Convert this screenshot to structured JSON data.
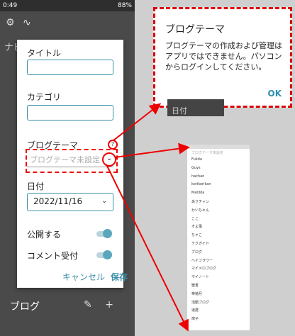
{
  "status_bar": {
    "time": "0:49",
    "battery": "88%"
  },
  "background": {
    "nav_label": "ナビ",
    "footer_label": "ブログ",
    "popup_under_label": "日付"
  },
  "dialog": {
    "title_label": "タイトル",
    "category_label": "カテゴリ",
    "blog_theme_label": "ブログテーマ",
    "blog_theme_placeholder": "ブログテーマ未設定",
    "date_label": "日付",
    "date_value": "2022/11/16",
    "publish_label": "公開する",
    "comments_label": "コメント受付",
    "cancel_label": "キャンセル",
    "save_label": "保存"
  },
  "popup": {
    "title": "ブログテーマ",
    "body": "ブログテーマの作成および管理はアプリではできません。パソコンからログインしてください。",
    "ok_label": "OK"
  },
  "theme_list": {
    "header": "ブログテーマ未設定",
    "items": [
      "Fukdu",
      "Guys",
      "hachan",
      "korikorikan",
      "Matilda",
      "あさチャン",
      "かいちゃん",
      "ここ",
      "そよ風",
      "ちゃこ",
      "テクガイド",
      "ブログ",
      "ヘイフラワー",
      "マイメロブログ",
      "マイノート",
      "聖書",
      "帝徳月",
      "活動ブログ",
      "道農",
      "扉子"
    ]
  },
  "colors": {
    "accent": "#3a8fa8",
    "annotation_red": "#e00000"
  }
}
